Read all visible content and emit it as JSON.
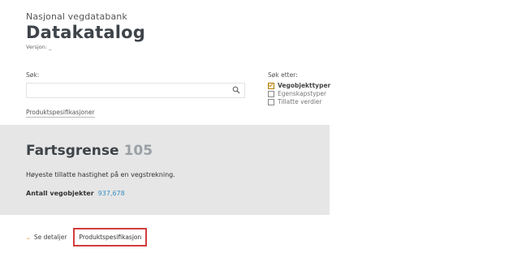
{
  "header": {
    "subtitle": "Nasjonal vegdatabank",
    "title": "Datakatalog",
    "version": "Versjon: _"
  },
  "search": {
    "label": "Søk:",
    "value": "",
    "placeholder": "",
    "icon": "search-icon",
    "product_link": "Produktspesifikasjoner"
  },
  "filters": {
    "label": "Søk etter:",
    "items": [
      {
        "label": "Vegobjekttyper",
        "checked": true
      },
      {
        "label": "Egenskapstyper",
        "checked": false
      },
      {
        "label": "Tillatte verdier",
        "checked": false
      }
    ]
  },
  "object_type": {
    "name": "Fartsgrense",
    "id": "105",
    "description": "Høyeste tillatte hastighet på en vegstrekning.",
    "count_label": "Antall vegobjekter",
    "count_value": "937,678"
  },
  "bottom": {
    "details_label": "Se detaljer",
    "product_button": "Produktspesifikasjon"
  },
  "colors": {
    "accent": "#e08a1e",
    "link": "#3a8fc0",
    "highlight_border": "#d43c3c",
    "panel_bg": "#e6e6e6"
  }
}
